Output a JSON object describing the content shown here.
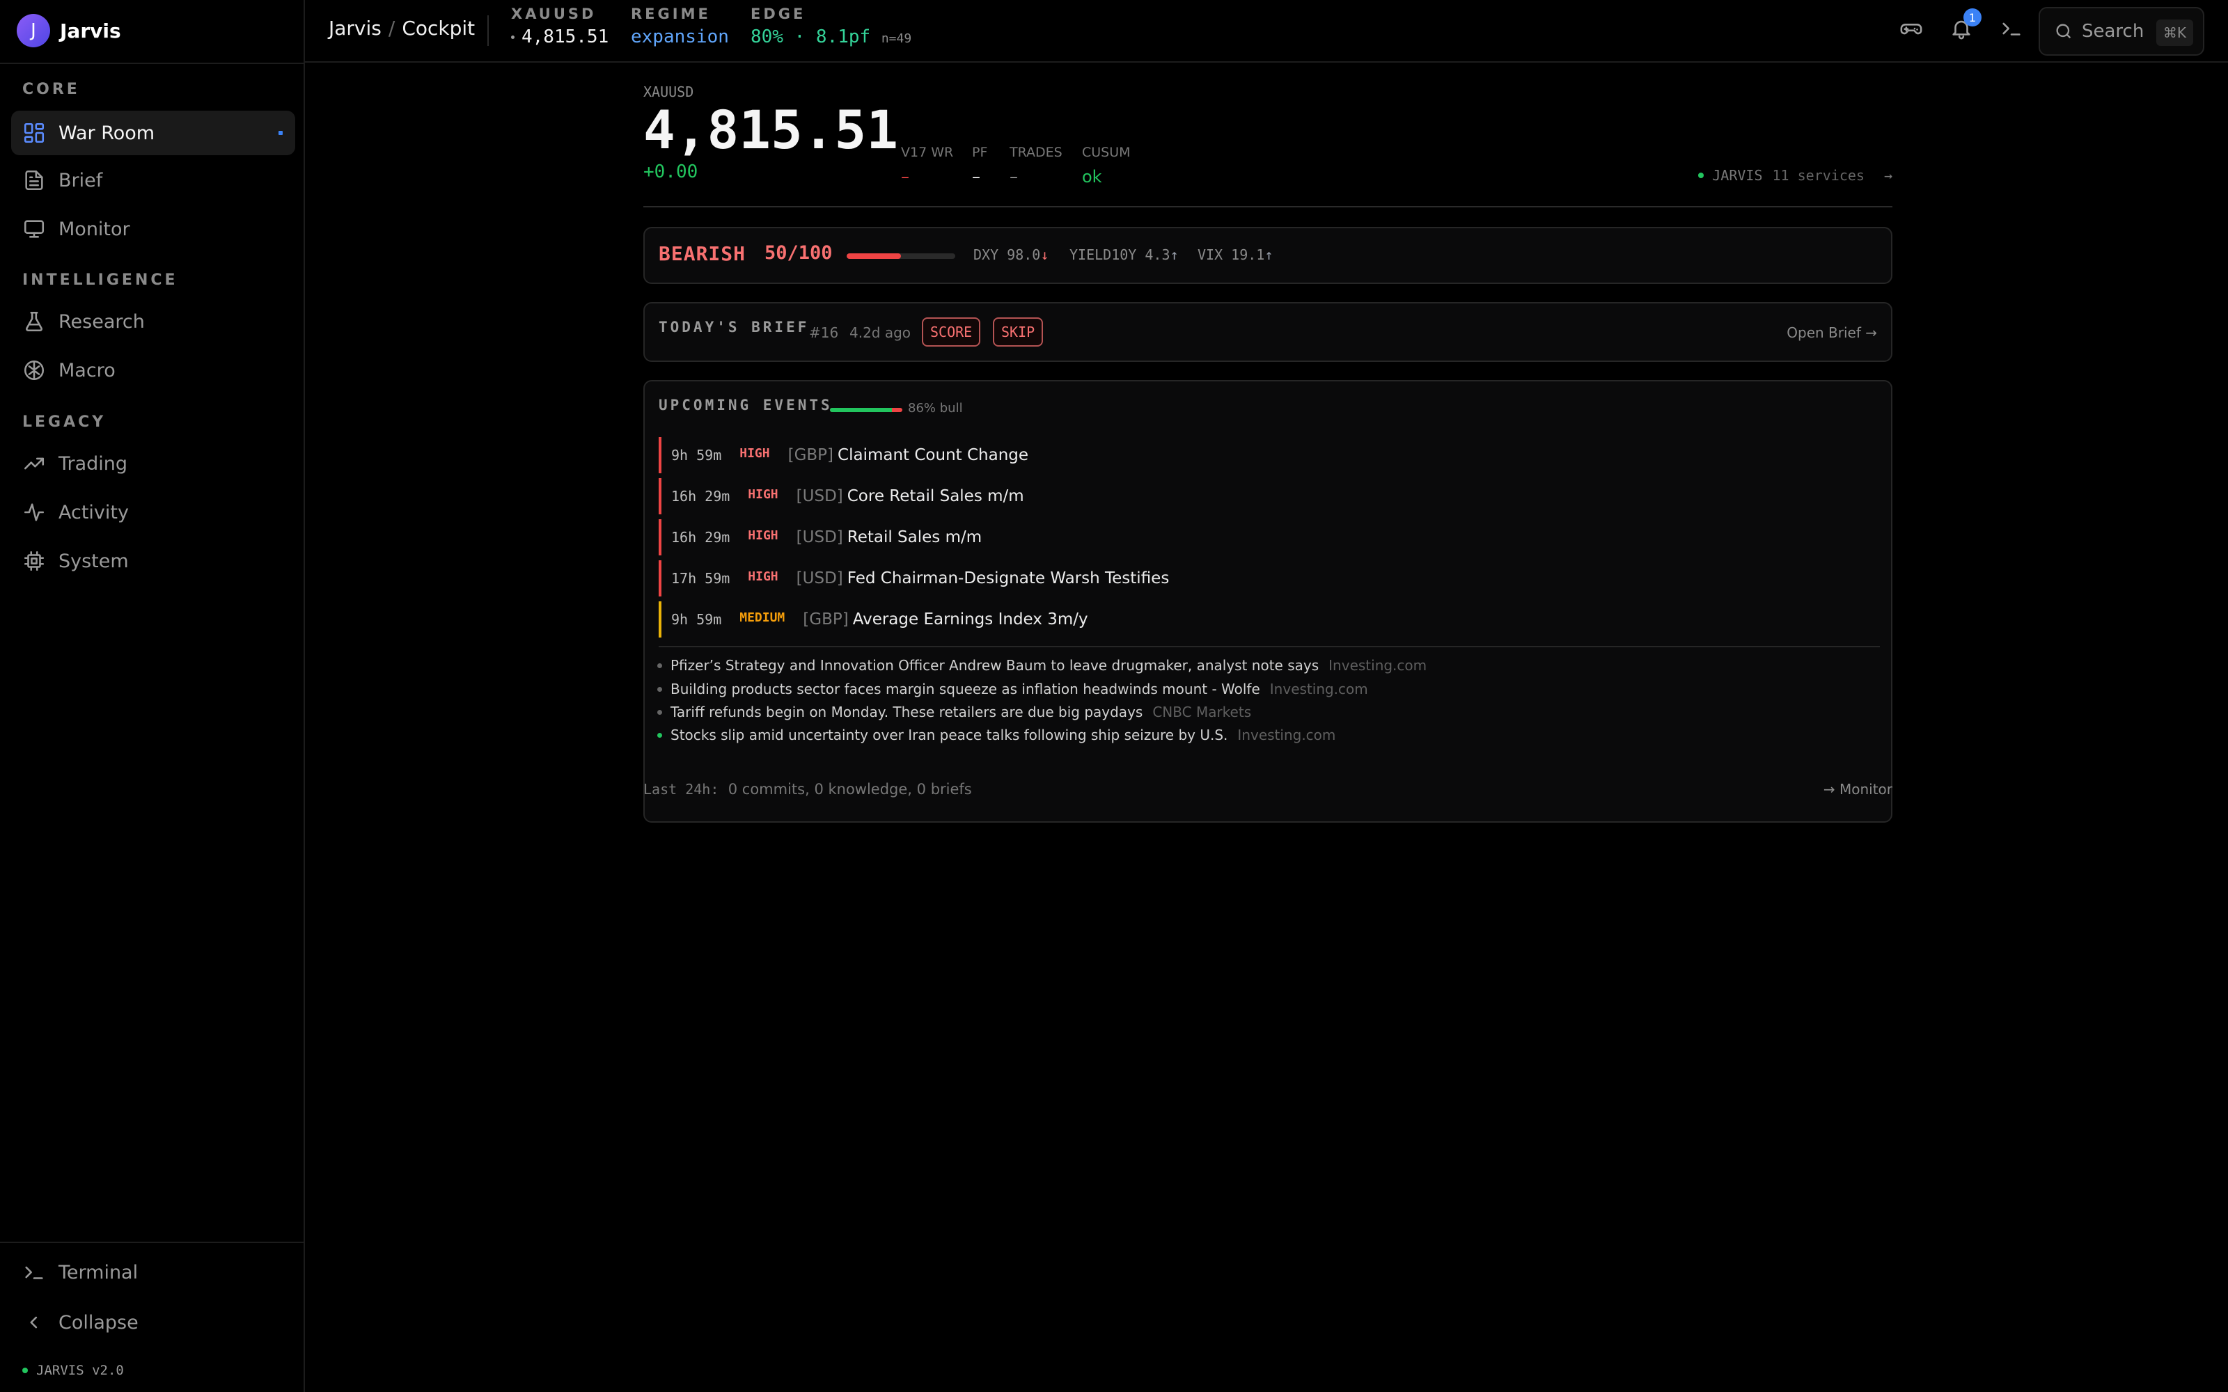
{
  "brand": {
    "avatar_letter": "J",
    "name": "Jarvis"
  },
  "sidebar": {
    "sections": [
      "CORE",
      "INTELLIGENCE",
      "LEGACY"
    ],
    "items": [
      {
        "label": "War Room",
        "icon": "layout-grid-icon",
        "active": true
      },
      {
        "label": "Brief",
        "icon": "document-icon"
      },
      {
        "label": "Monitor",
        "icon": "monitor-icon"
      },
      {
        "label": "Research",
        "icon": "flask-icon"
      },
      {
        "label": "Macro",
        "icon": "brain-icon"
      },
      {
        "label": "Trading",
        "icon": "trending-up-icon"
      },
      {
        "label": "Activity",
        "icon": "activity-icon"
      },
      {
        "label": "System",
        "icon": "cpu-icon"
      }
    ],
    "terminal_label": "Terminal",
    "collapse_label": "Collapse",
    "version": "JARVIS v2.0"
  },
  "topbar": {
    "breadcrumb": [
      "Jarvis",
      "Cockpit"
    ],
    "symbol_label": "XAUUSD",
    "symbol_value": "4,815.51",
    "regime_label": "REGIME",
    "regime_value": "expansion",
    "edge_label": "EDGE",
    "edge_value": "80% · 8.1pf",
    "edge_n": "n=49",
    "notifications": "1",
    "search_placeholder": "Search",
    "search_shortcut": "⌘K",
    "accent": "#3b82f6"
  },
  "ticker": {
    "symbol": "XAUUSD",
    "price": "4,815.51",
    "change": "+0.00",
    "metrics": [
      {
        "label": "V17 WR",
        "value": "–",
        "color": "#ef4444"
      },
      {
        "label": "PF",
        "value": "–",
        "color": "#f5f5f5"
      },
      {
        "label": "TRADES",
        "value": "–",
        "color": "#9a9a9a"
      },
      {
        "label": "CUSUM",
        "value": "ok",
        "color": "#22c55e"
      }
    ],
    "status_name": "JARVIS",
    "status_services": "11 services",
    "status_arrow": "→"
  },
  "sentiment": {
    "label": "BEARISH",
    "score": "50/100",
    "score_fraction": 0.5,
    "macro": [
      {
        "text": "DXY 98.0",
        "arrow": "↓",
        "dir": "down"
      },
      {
        "text": "YIELD10Y 4.3",
        "arrow": "↑",
        "dir": "up"
      },
      {
        "text": "VIX 19.1",
        "arrow": "↑",
        "dir": "up"
      }
    ]
  },
  "brief": {
    "title": "TODAY'S BRIEF",
    "number": "#16",
    "age": "4.2d ago",
    "pills": [
      "SCORE",
      "SKIP"
    ],
    "open_label": "Open Brief →"
  },
  "events": {
    "title": "UPCOMING EVENTS",
    "bull_fraction": 0.86,
    "bull_label": "86% bull",
    "items": [
      {
        "time": "9h 59m",
        "impact": "HIGH",
        "currency": "[GBP]",
        "name": "Claimant Count Change"
      },
      {
        "time": "16h 29m",
        "impact": "HIGH",
        "currency": "[USD]",
        "name": "Core Retail Sales m/m"
      },
      {
        "time": "16h 29m",
        "impact": "HIGH",
        "currency": "[USD]",
        "name": "Retail Sales m/m"
      },
      {
        "time": "17h 59m",
        "impact": "HIGH",
        "currency": "[USD]",
        "name": "Fed Chairman-Designate Warsh Testifies"
      },
      {
        "time": "9h 59m",
        "impact": "MEDIUM",
        "currency": "[GBP]",
        "name": "Average Earnings Index 3m/y"
      }
    ],
    "news": [
      {
        "headline": "Pfizer’s Strategy and Innovation Officer Andrew Baum to leave drugmaker, analyst note says",
        "source": "Investing.com",
        "sentiment": "neutral"
      },
      {
        "headline": "Building products sector faces margin squeeze as inflation headwinds mount - Wolfe",
        "source": "Investing.com",
        "sentiment": "neutral"
      },
      {
        "headline": "Tariff refunds begin on Monday. These retailers are due big paydays",
        "source": "CNBC Markets",
        "sentiment": "neutral"
      },
      {
        "headline": "Stocks slip amid uncertainty over Iran peace talks following ship seizure by U.S.",
        "source": "Investing.com",
        "sentiment": "positive"
      }
    ]
  },
  "footer": {
    "label": "Last 24h:",
    "summary": "0 commits, 0 knowledge, 0 briefs",
    "link": "→ Monitor"
  }
}
